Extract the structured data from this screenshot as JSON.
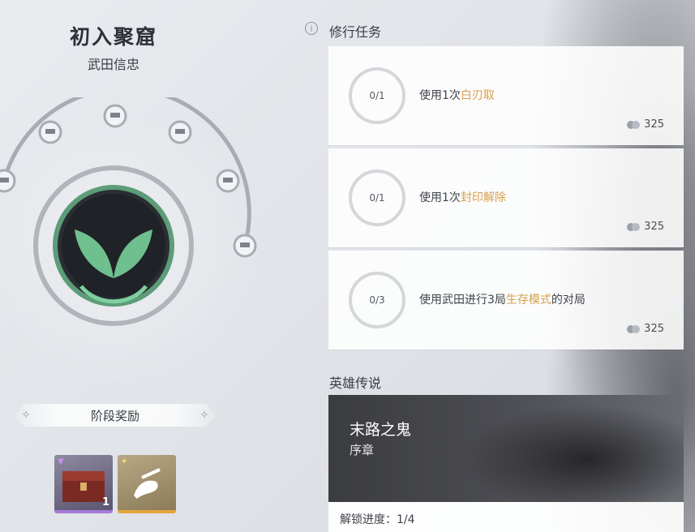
{
  "hero": {
    "title": "初入聚窟",
    "subtitle": "武田信忠"
  },
  "stage_rewards": {
    "label": "阶段奖励",
    "items": [
      {
        "name": "chest",
        "count": "1",
        "rarity_color": "#a679d8"
      },
      {
        "name": "gesture",
        "count": "",
        "rarity_color": "#e3a53c"
      }
    ]
  },
  "tasks_section": {
    "heading": "修行任务",
    "tasks": [
      {
        "progress": "0/1",
        "prefix": "使用1次",
        "highlight": "白刃取",
        "suffix": "",
        "reward": "325"
      },
      {
        "progress": "0/1",
        "prefix": "使用1次",
        "highlight": "封印解除",
        "suffix": "",
        "reward": "325"
      },
      {
        "progress": "0/3",
        "prefix": "使用武田进行3局",
        "highlight": "生存模式",
        "suffix": "的对局",
        "reward": "325"
      }
    ]
  },
  "legend_section": {
    "heading": "英雄传说",
    "title": "末路之鬼",
    "chapter": "序章",
    "progress_text": "解锁进度：1/4"
  },
  "colors": {
    "highlight": "#d99f4a",
    "emblem_green": "#6fbf8f"
  }
}
